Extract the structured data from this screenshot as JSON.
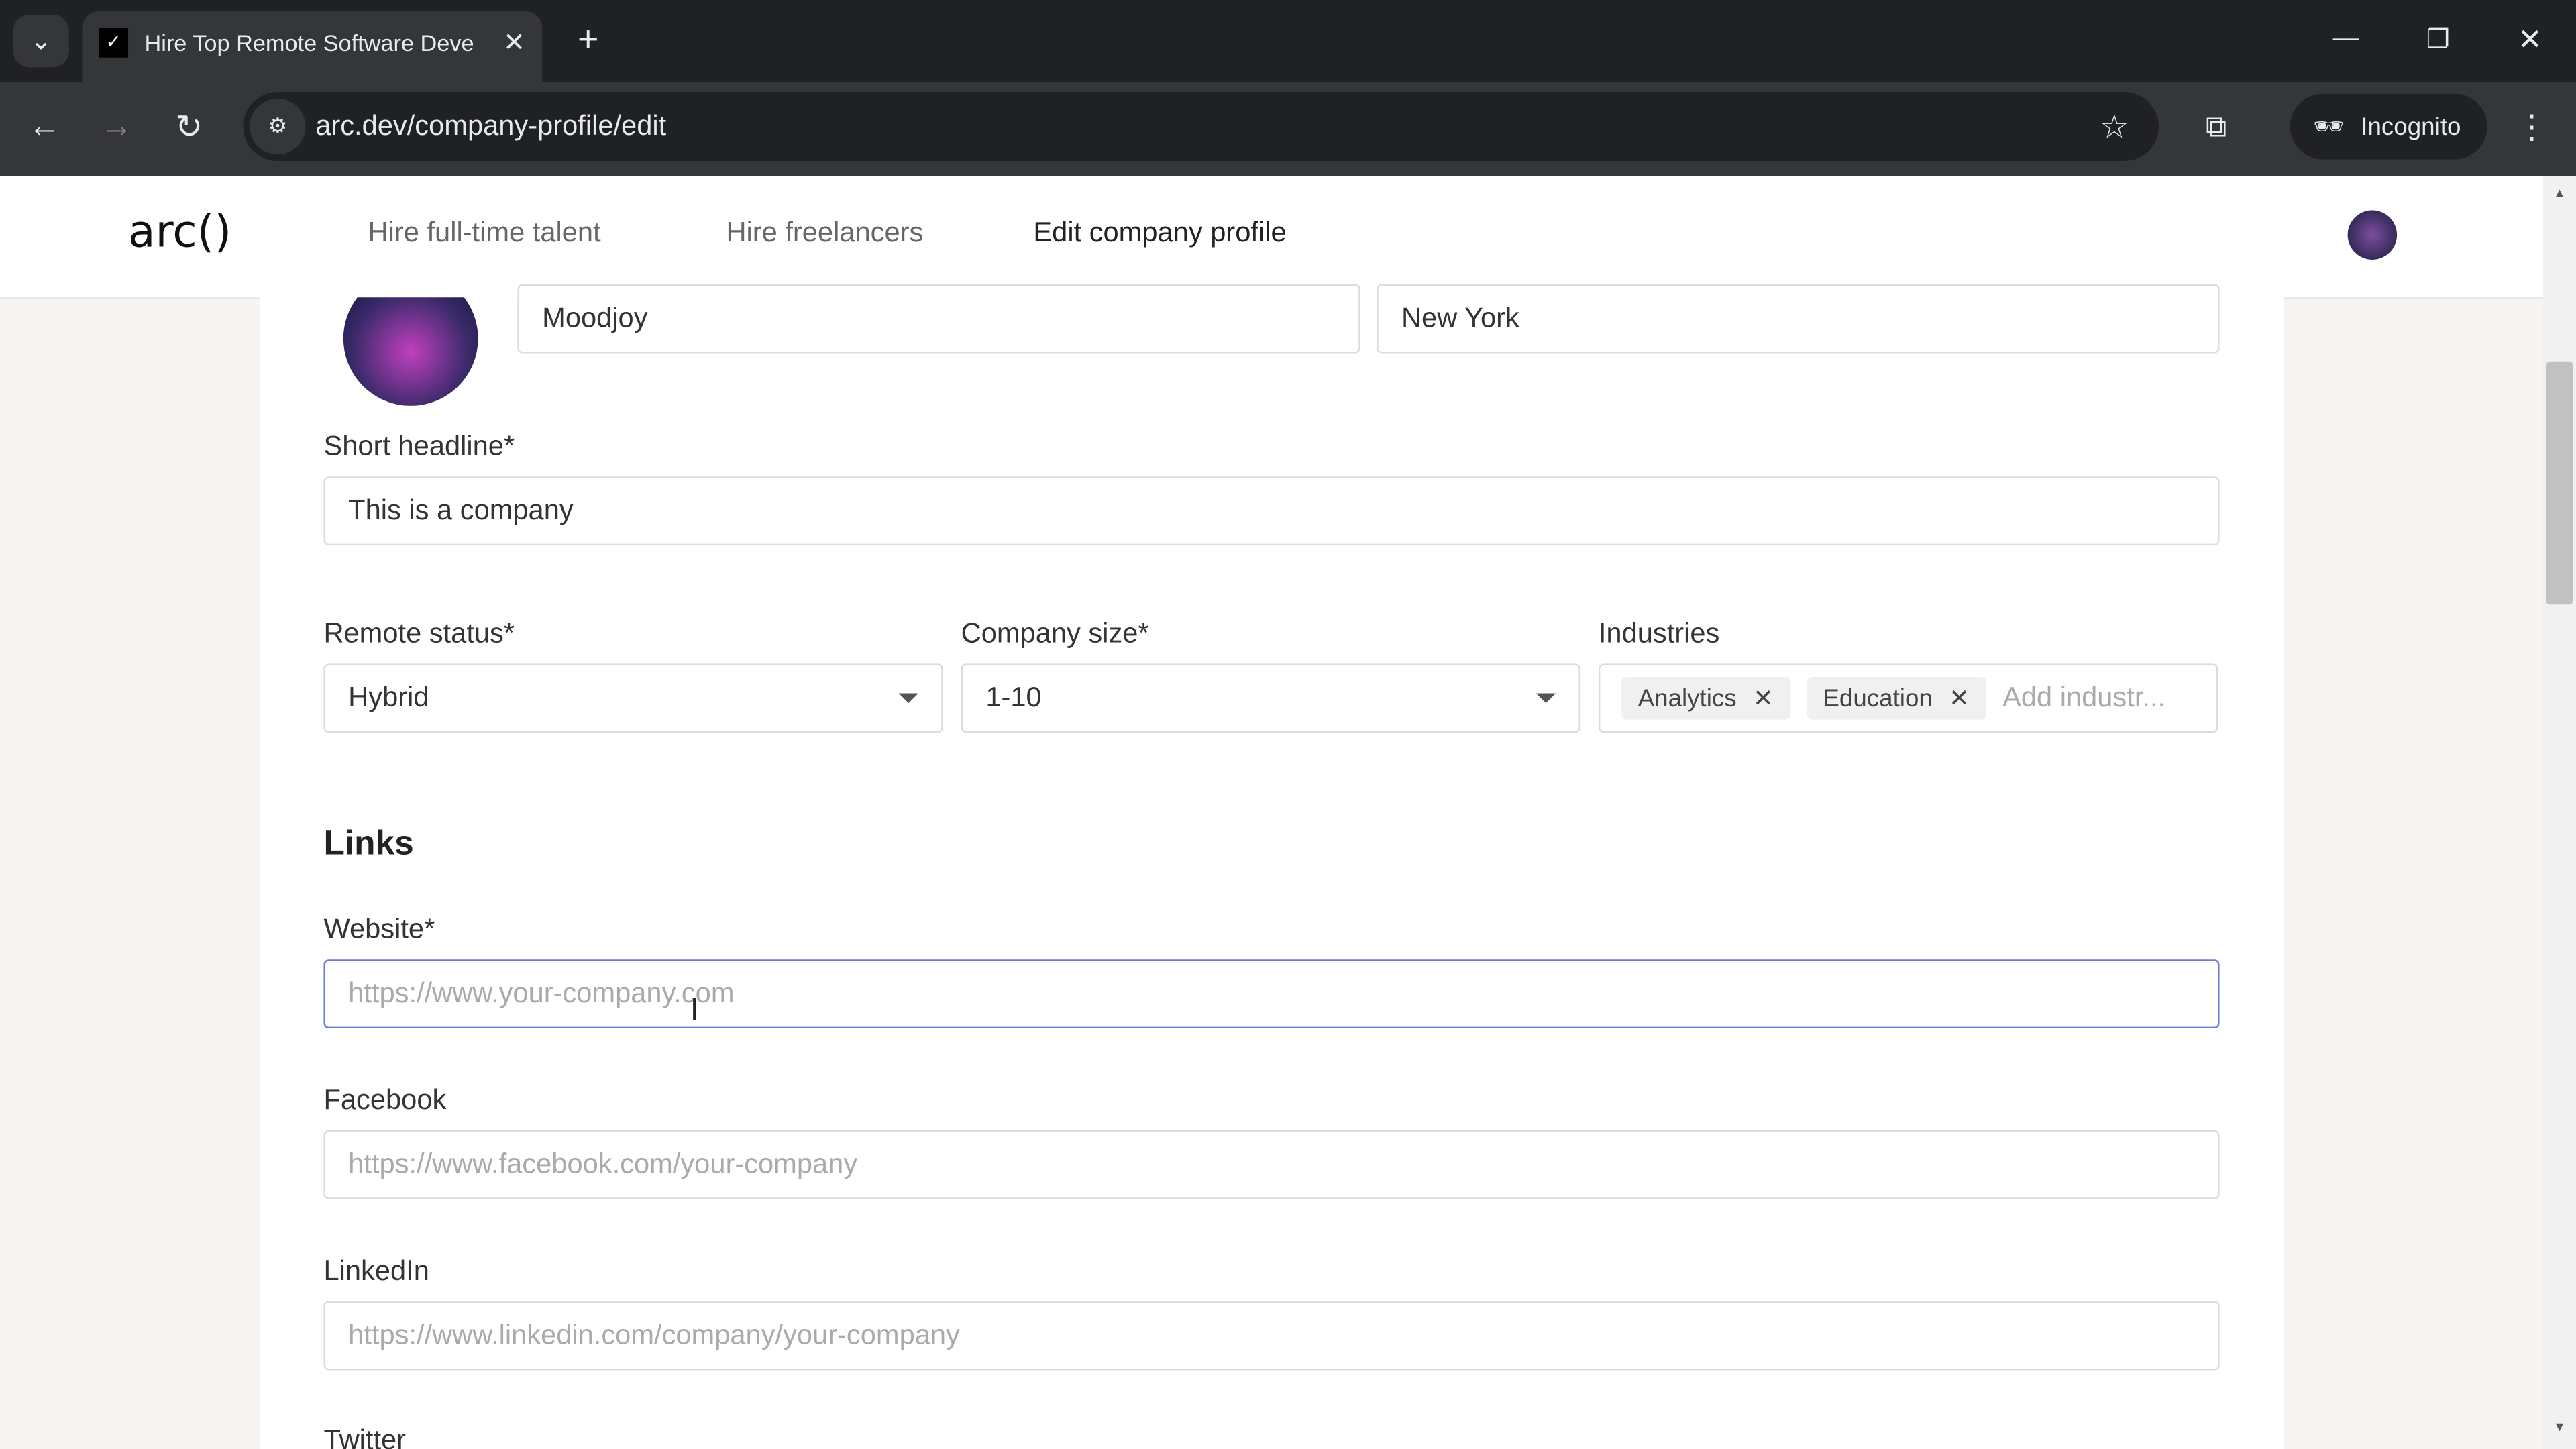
{
  "browser": {
    "tab_title": "Hire Top Remote Software Deve",
    "url": "arc.dev/company-profile/edit",
    "profile_label": "Incognito"
  },
  "nav": {
    "logo": "arc()",
    "links": [
      "Hire full-time talent",
      "Hire freelancers",
      "Edit company profile"
    ]
  },
  "form": {
    "company_name": "Moodjoy",
    "location": "New York",
    "headline_label": "Short headline*",
    "headline_value": "This is a company",
    "remote_label": "Remote status*",
    "remote_value": "Hybrid",
    "size_label": "Company size*",
    "size_value": "1-10",
    "industries_label": "Industries",
    "industries": [
      "Analytics",
      "Education"
    ],
    "industries_placeholder": "Add industr...",
    "links_heading": "Links",
    "website_label": "Website*",
    "website_placeholder": "https://www.your-company.com",
    "facebook_label": "Facebook",
    "facebook_placeholder": "https://www.facebook.com/your-company",
    "linkedin_label": "LinkedIn",
    "linkedin_placeholder": "https://www.linkedin.com/company/your-company",
    "twitter_label": "Twitter"
  },
  "colors": {
    "focus_border": "#6b7bd6",
    "page_bg": "#f7f5f2"
  }
}
